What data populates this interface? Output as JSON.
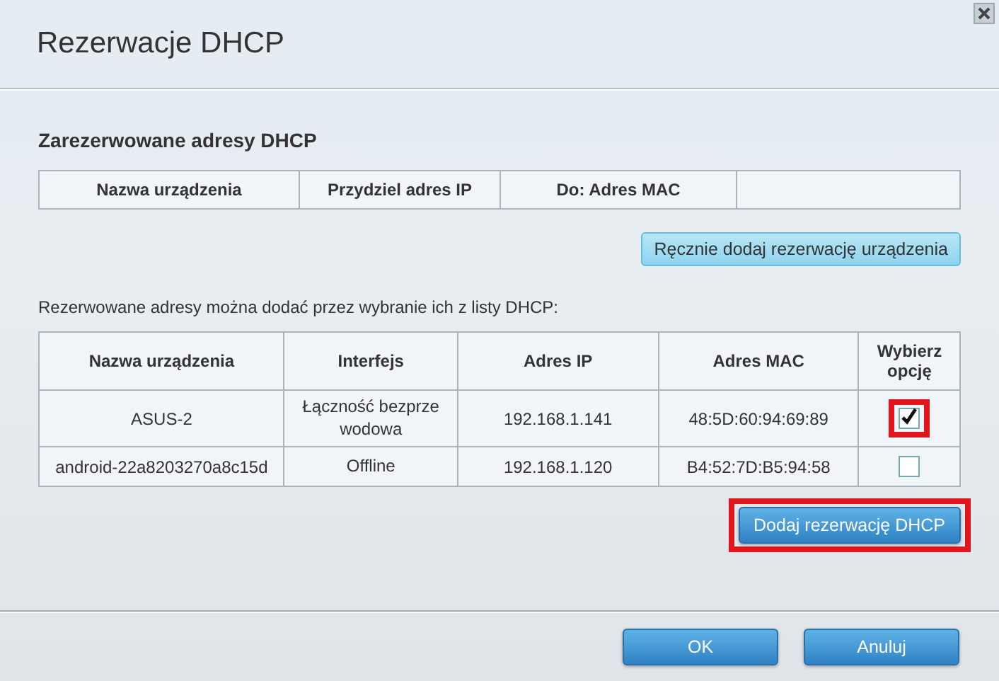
{
  "dialog": {
    "title": "Rezerwacje DHCP"
  },
  "reserved": {
    "heading": "Zarezerwowane adresy DHCP",
    "columns": [
      "Nazwa urządzenia",
      "Przydziel adres IP",
      "Do: Adres MAC"
    ],
    "button": "Ręcznie dodaj rezerwację urządzenia"
  },
  "dhcp_list": {
    "intro": "Rezerwowane adresy można dodać przez wybranie ich z listy DHCP:",
    "columns": [
      "Nazwa urządzenia",
      "Interfejs",
      "Adres IP",
      "Adres MAC",
      "Wybierz opcję"
    ],
    "rows": [
      {
        "name": "ASUS-2",
        "interface": "Łączność bezprzewodowa",
        "ip": "192.168.1.141",
        "mac": "48:5D:60:94:69:89",
        "checked": true,
        "highlighted": true
      },
      {
        "name": "android-22a8203270a8c15d",
        "interface": "Offline",
        "ip": "192.168.1.120",
        "mac": "B4:52:7D:B5:94:58",
        "checked": false,
        "highlighted": false
      }
    ],
    "button": {
      "label": "Dodaj rezerwację DHCP",
      "highlighted": true
    }
  },
  "footer": {
    "buttons": [
      "OK",
      "Anuluj"
    ]
  }
}
